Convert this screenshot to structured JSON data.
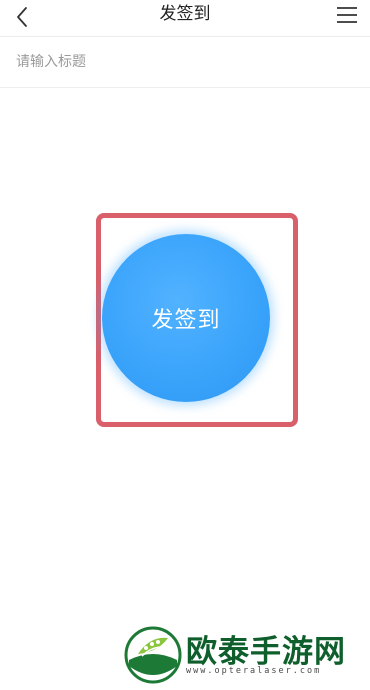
{
  "header": {
    "title": "发签到",
    "back_icon": "chevron-left-icon",
    "menu_icon": "hamburger-menu-icon"
  },
  "form": {
    "title_placeholder": "请输入标题",
    "title_value": ""
  },
  "sign_button": {
    "label": "发签到",
    "color": "#3aa4fb"
  },
  "annotation": {
    "highlight_color": "#d95f6a"
  },
  "watermark": {
    "text": "欧泰手游网",
    "url": "www.opteralaser.com",
    "logo_icon": "wheat-leaf-logo",
    "color": "#0f5f2c"
  }
}
